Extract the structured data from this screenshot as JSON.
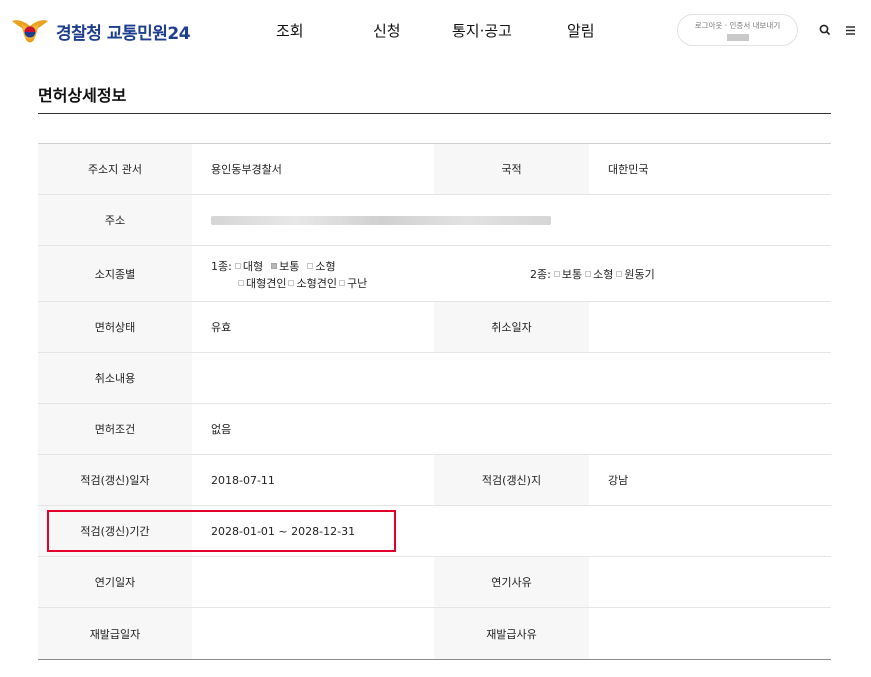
{
  "header": {
    "logo_text": "경찰청 교통민원24",
    "nav": [
      {
        "label": "조회"
      },
      {
        "label": "신청"
      },
      {
        "label": "통지·공고"
      },
      {
        "label": "알림"
      }
    ],
    "auth_links": "로그아웃 · 인증서 내보내기"
  },
  "page_title": "면허상세정보",
  "table": {
    "jurisdiction": {
      "label": "주소지 관서",
      "value": "용인동부경찰서"
    },
    "nationality": {
      "label": "국적",
      "value": "대한민국"
    },
    "address": {
      "label": "주소"
    },
    "license_types": {
      "label": "소지종별",
      "class1_prefix": "1종:",
      "class1_items": [
        {
          "label": "대형",
          "checked": false
        },
        {
          "label": "보통",
          "checked": true
        },
        {
          "label": "소형",
          "checked": false
        }
      ],
      "class1_items_row2": [
        {
          "label": "대형견인",
          "checked": false
        },
        {
          "label": "소형견인",
          "checked": false
        },
        {
          "label": "구난",
          "checked": false
        }
      ],
      "class2_prefix": "2종:",
      "class2_items": [
        {
          "label": "보통",
          "checked": false
        },
        {
          "label": "소형",
          "checked": false
        },
        {
          "label": "원동기",
          "checked": false
        }
      ]
    },
    "license_status": {
      "label": "면허상태",
      "value": "유효"
    },
    "cancel_date": {
      "label": "취소일자",
      "value": ""
    },
    "cancel_detail": {
      "label": "취소내용",
      "value": ""
    },
    "license_condition": {
      "label": "면허조건",
      "value": "없음"
    },
    "renewal_date": {
      "label": "적검(갱신)일자",
      "value": "2018-07-11"
    },
    "renewal_place": {
      "label": "적검(갱신)지",
      "value": "강남"
    },
    "renewal_period": {
      "label": "적검(갱신)기간",
      "value": "2028-01-01 ~ 2028-12-31"
    },
    "postpone_date": {
      "label": "연기일자",
      "value": ""
    },
    "postpone_reason": {
      "label": "연기사유",
      "value": ""
    },
    "reissue_date": {
      "label": "재발급일자",
      "value": ""
    },
    "reissue_reason": {
      "label": "재발급사유",
      "value": ""
    }
  },
  "colors": {
    "brand": "#1d3d8f",
    "highlight": "#e4002b",
    "header_cell": "#f7f7f7"
  }
}
